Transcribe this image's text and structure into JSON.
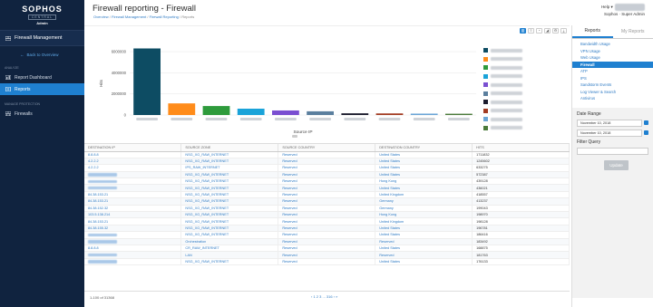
{
  "sidebar": {
    "brand": "SOPHOS",
    "brand_sub": "CENTRAL",
    "brand_role": "Admin",
    "module": "Firewall Management",
    "back": "Back to Overview",
    "section_analyze": "ANALYZE",
    "items": [
      {
        "label": "Report Dashboard"
      },
      {
        "label": "Reports"
      }
    ],
    "section_manage": "MANAGE PROTECTION",
    "manage_items": [
      {
        "label": "Firewalls"
      }
    ]
  },
  "header": {
    "title": "Firewall reporting - Firewall",
    "breadcrumb": [
      "Overview",
      "Firewall Management",
      "Firewall Reporting",
      "Reports"
    ],
    "help": "Help",
    "user_role": "Sophos · Super Admin"
  },
  "toolbar": [
    "bar",
    "table",
    "pie",
    "area",
    "settings",
    "download"
  ],
  "chart_data": {
    "type": "bar",
    "xlabel": "Source IP",
    "ylabel": "Hits",
    "yticks": [
      "0",
      "2000000",
      "4000000",
      "6000000"
    ],
    "ylim": [
      0,
      6000000
    ],
    "values": [
      6300000,
      1100000,
      850000,
      600000,
      430000,
      350000,
      160000,
      150000,
      130000,
      120000
    ],
    "colors": [
      "#0d4c63",
      "#ff8c1a",
      "#2e9b3c",
      "#1aa3d9",
      "#7a4fd1",
      "#5b7f9e",
      "#1c1c2e",
      "#a23b22",
      "#6aa5d6",
      "#4a7a3a"
    ]
  },
  "legend_colors": [
    "#0d4c63",
    "#ff8c1a",
    "#2e9b3c",
    "#1aa3d9",
    "#7a4fd1",
    "#5b7f9e",
    "#1c1c2e",
    "#a23b22",
    "#6aa5d6",
    "#4a7a3a"
  ],
  "table": {
    "headers": [
      "DESTINATION IP",
      "SOURCE ZONE",
      "SOURCE COUNTRY",
      "DESTINATION COUNTRY",
      "HITS"
    ],
    "rows": [
      [
        "8.8.8.8",
        "NSG_XG_RAW_INTERNET",
        "Reserved",
        "United States",
        "1711832"
      ],
      [
        "4.2.2.2",
        "NSG_XG_RAW_INTERNET",
        "Reserved",
        "United States",
        "1245602"
      ],
      [
        "4.2.2.2",
        "IPS_RAW_INTERNET",
        "Reserved",
        "United States",
        "633275"
      ],
      [
        "",
        "NSG_XG_RAW_INTERNET",
        "Reserved",
        "United States",
        "572387"
      ],
      [
        "",
        "NSG_XG_RAW_INTERNET",
        "Reserved",
        "Hong Kong",
        "439128"
      ],
      [
        "",
        "NSG_XG_RAW_INTERNET",
        "Reserved",
        "United States",
        "436021"
      ],
      [
        "84.38.153.21",
        "NSG_XG_RAW_INTERNET",
        "Reserved",
        "United Kingdom",
        "418557"
      ],
      [
        "84.38.153.21",
        "NSG_XG_RAW_INTERNET",
        "Reserved",
        "Germany",
        "413237"
      ],
      [
        "84.38.152.32",
        "NSG_XG_RAW_INTERNET",
        "Reserved",
        "Germany",
        "199043"
      ],
      [
        "103.5.138.214",
        "NSG_XG_RAW_INTERNET",
        "Reserved",
        "Hong Kong",
        "198970"
      ],
      [
        "84.38.153.21",
        "NSG_XG_RAW_INTERNET",
        "Reserved",
        "United Kingdom",
        "198128"
      ],
      [
        "84.38.155.32",
        "NSG_XG_RAW_INTERNET",
        "Reserved",
        "United States",
        "196781"
      ],
      [
        "",
        "NSG_XG_RAW_INTERNET",
        "Reserved",
        "United States",
        "186416"
      ],
      [
        "",
        "Orchestration",
        "Reserved",
        "Reserved",
        "183492"
      ],
      [
        "8.8.8.8",
        "CR_RAW_INTERNET",
        "Reserved",
        "United States",
        "168875"
      ],
      [
        "",
        "LAN",
        "Reserved",
        "Reserved",
        "181763"
      ],
      [
        "",
        "NSG_XG_RAW_INTERNET",
        "Reserved",
        "United States",
        "176133"
      ]
    ]
  },
  "footer": {
    "count": "1-100 of 31368",
    "pager": "‹ 1 2 3 ... 316 › »"
  },
  "right_panel": {
    "tabs": [
      "Reports",
      "My Reports"
    ],
    "items": [
      "Bandwidth Usage",
      "VPN Usage",
      "Web Usage",
      "Firewall",
      "ATP",
      "IPS",
      "Sandstorm Events",
      "Log Viewer & Search",
      "Antivirus"
    ],
    "active_index": 3,
    "date_range_label": "Date Range",
    "date_from": "November 10, 2018",
    "date_to": "November 10, 2018",
    "filter_label": "Filter Query",
    "filter_placeholder": "",
    "update_label": "Update"
  }
}
